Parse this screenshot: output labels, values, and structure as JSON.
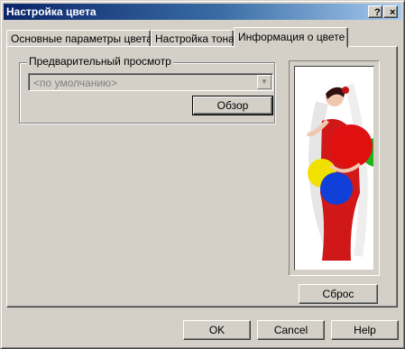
{
  "window": {
    "title": "Настройка цвета"
  },
  "titlebar_buttons": {
    "help": "?",
    "close": "×"
  },
  "tabs": [
    {
      "label": "Основные параметры цвета"
    },
    {
      "label": "Настройка тона"
    },
    {
      "label": "Информация о цвете"
    }
  ],
  "preview_group": {
    "label": "Предварительный просмотр",
    "combo_value": "<по умолчанию>",
    "browse_label": "Обзор"
  },
  "reset_label": "Сброс",
  "footer": {
    "ok": "OK",
    "cancel": "Cancel",
    "help": "Help"
  },
  "colors": {
    "title_start": "#0a246a",
    "title_end": "#a6caf0",
    "face": "#d4d0c8"
  }
}
